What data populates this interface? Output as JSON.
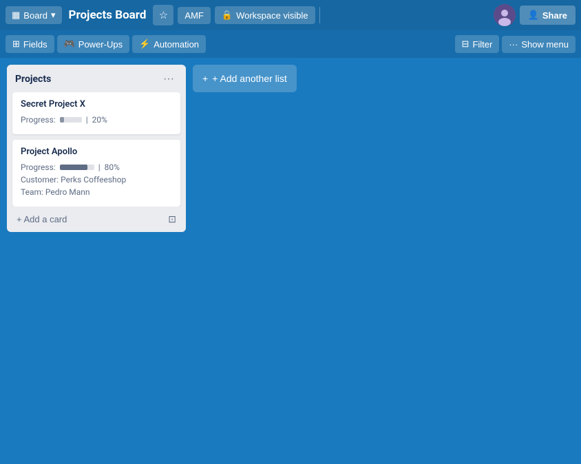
{
  "header": {
    "board_label": "Board",
    "title": "Projects Board",
    "amf_label": "AMF",
    "workspace_label": "Workspace visible",
    "share_label": "Share"
  },
  "toolbar": {
    "fields_label": "Fields",
    "powerups_label": "Power-Ups",
    "automation_label": "Automation",
    "filter_label": "Filter",
    "show_menu_label": "Show menu"
  },
  "list": {
    "title": "Projects",
    "cards": [
      {
        "id": 1,
        "title": "Secret Project X",
        "progress_label": "Progress:",
        "progress_value": "20%",
        "progress_pct": 20
      },
      {
        "id": 2,
        "title": "Project Apollo",
        "progress_label": "Progress:",
        "progress_value": "80%",
        "progress_pct": 80,
        "customer_label": "Customer: Perks Coffeeshop",
        "team_label": "Team: Pedro Mann"
      }
    ],
    "add_card_label": "+ Add a card"
  },
  "board": {
    "add_list_label": "+ Add another list"
  },
  "icons": {
    "board": "▦",
    "chevron_down": "▾",
    "star": "☆",
    "lock": "🔒",
    "person": "👤",
    "fields": "⊞",
    "powerups": "🎮",
    "lightning": "⚡",
    "filter": "⊟",
    "dots": "···",
    "plus": "+",
    "template": "⊡"
  }
}
